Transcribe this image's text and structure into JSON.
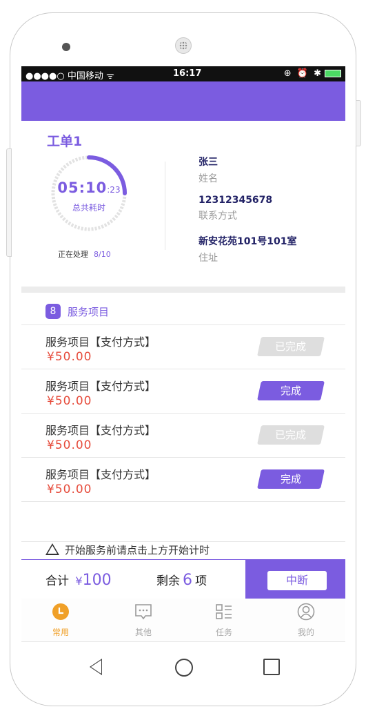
{
  "status_bar": {
    "carrier": "●●●●○ 中国移动 ᯤ",
    "time": "16:17",
    "icons": "⊕ ⏰ ✱"
  },
  "order": {
    "title": "工单1",
    "timer": {
      "big": "05:10",
      "small": ":23",
      "label": "总共耗时"
    },
    "progress_label": "正在处理",
    "progress_value": "8/10",
    "contact_name": "张三",
    "contact_name_label": "姓名",
    "phone": "12312345678",
    "phone_label": "联系方式",
    "address": "新安花苑101号101室",
    "address_label": "住址",
    "timer_fraction": 0.25
  },
  "services": {
    "badge": "8",
    "title": "服务项目",
    "items": [
      {
        "name": "服务项目【支付方式】",
        "price": "¥50.00",
        "button": "已完成",
        "state": "done"
      },
      {
        "name": "服务项目【支付方式】",
        "price": "¥50.00",
        "button": "完成",
        "state": "active"
      },
      {
        "name": "服务项目【支付方式】",
        "price": "¥50.00",
        "button": "已完成",
        "state": "done"
      },
      {
        "name": "服务项目【支付方式】",
        "price": "¥50.00",
        "button": "完成",
        "state": "active"
      }
    ]
  },
  "tip": "开始服务前请点击上方开始计时",
  "footer": {
    "total_label": "合计",
    "currency": "¥",
    "total_amount": "100",
    "remain_label": "剩余",
    "remain_count": "6",
    "remain_unit": "项",
    "interrupt_button": "中断"
  },
  "tabs": [
    {
      "label": "常用",
      "icon": "clock-icon",
      "active": true
    },
    {
      "label": "其他",
      "icon": "chat-icon",
      "active": false
    },
    {
      "label": "任务",
      "icon": "task-list-icon",
      "active": false
    },
    {
      "label": "我的",
      "icon": "user-icon",
      "active": false
    }
  ],
  "colors": {
    "accent": "#7b5ce0",
    "price": "#e64b3b",
    "active_tab": "#f0a028"
  }
}
